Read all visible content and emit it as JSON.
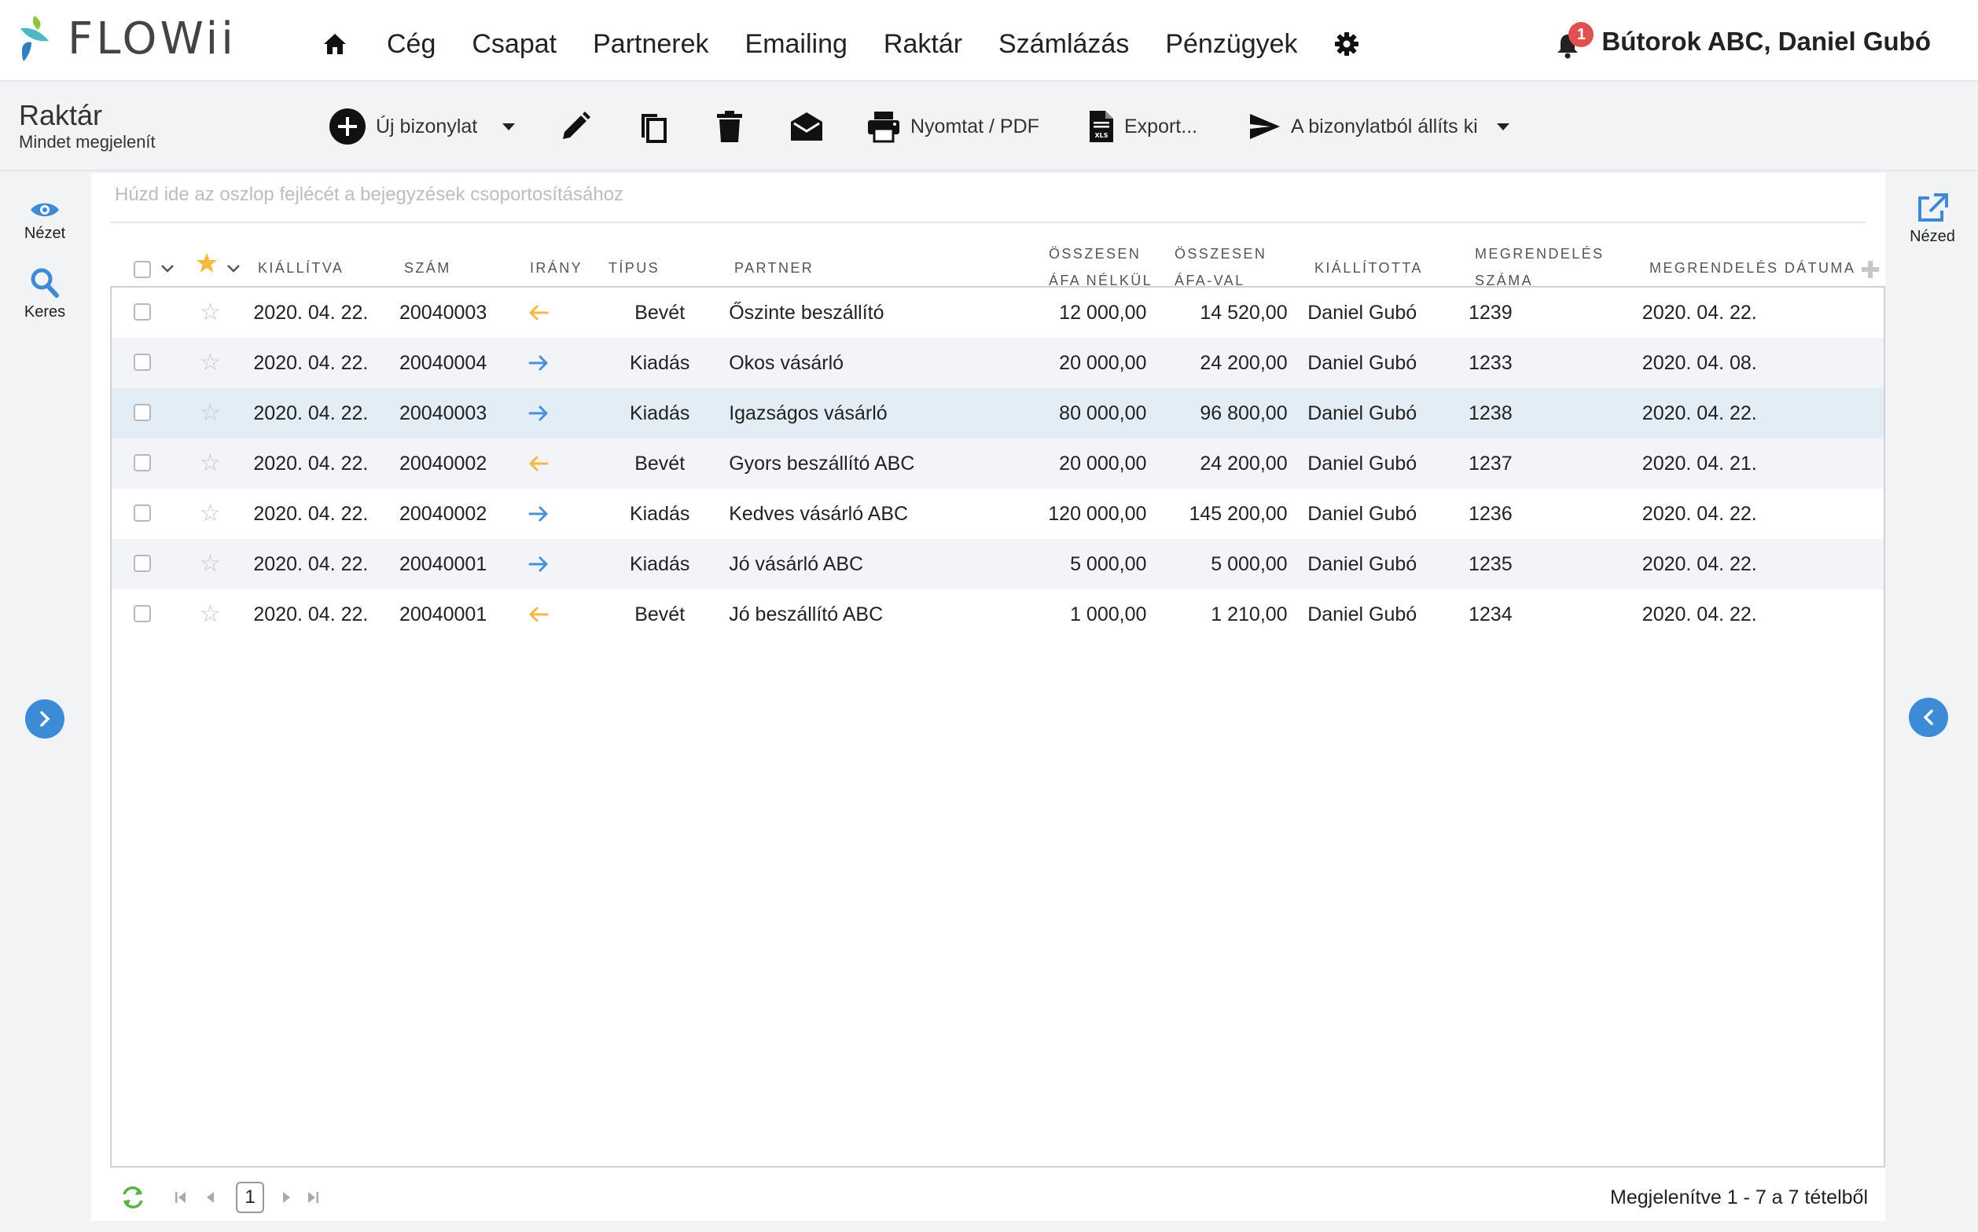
{
  "app": {
    "logo_text": "FLOWii",
    "brand_colors": {
      "teal": "#4bb8c4",
      "green": "#8cc63f",
      "blue": "#2f7fc0"
    }
  },
  "nav": {
    "items": [
      "Cég",
      "Csapat",
      "Partnerek",
      "Emailing",
      "Raktár",
      "Számlázás",
      "Pénzügyek"
    ],
    "home_icon": "home-icon",
    "settings_icon": "gear-icon"
  },
  "user": {
    "notification_count": "1",
    "name": "Bútorok ABC, Daniel Gubó"
  },
  "toolbar": {
    "title": "Raktár",
    "subtitle": "Mindet megjelenít",
    "new_doc": "Új bizonylat",
    "print": "Nyomtat / PDF",
    "export": "Export...",
    "issue_from": "A bizonylatból állíts ki"
  },
  "left_rail": {
    "view": "Nézet",
    "search": "Keres"
  },
  "right_rail": {
    "view": "Nézed"
  },
  "grid": {
    "group_hint": "Húzd ide az oszlop fejlécét a bejegyzések csoportosításához",
    "columns": {
      "issued": "KIÁLLÍTVA",
      "number": "SZÁM",
      "direction": "IRÁNY",
      "type": "TÍPUS",
      "partner": "PARTNER",
      "net_line1": "ÖSSZESEN",
      "net_line2": "ÁFA NÉLKÜL",
      "gross_line1": "ÖSSZESEN",
      "gross_line2": "ÁFA-VAL",
      "issued_by": "KIÁLLÍTOTTA",
      "order_no_line1": "MEGRENDELÉS",
      "order_no_line2": "SZÁMA",
      "order_date": "MEGRENDELÉS DÁTUMA"
    },
    "rows": [
      {
        "issued": "2020. 04. 22.",
        "number": "20040003",
        "direction": "in",
        "type": "Bevét",
        "partner": "Őszinte beszállító",
        "net": "12 000,00",
        "gross": "14 520,00",
        "issued_by": "Daniel Gubó",
        "order_no": "1239",
        "order_date": "2020. 04. 22."
      },
      {
        "issued": "2020. 04. 22.",
        "number": "20040004",
        "direction": "out",
        "type": "Kiadás",
        "partner": "Okos vásárló",
        "net": "20 000,00",
        "gross": "24 200,00",
        "issued_by": "Daniel Gubó",
        "order_no": "1233",
        "order_date": "2020. 04. 08."
      },
      {
        "issued": "2020. 04. 22.",
        "number": "20040003",
        "direction": "out",
        "type": "Kiadás",
        "partner": "Igazságos vásárló",
        "net": "80 000,00",
        "gross": "96 800,00",
        "issued_by": "Daniel Gubó",
        "order_no": "1238",
        "order_date": "2020. 04. 22."
      },
      {
        "issued": "2020. 04. 22.",
        "number": "20040002",
        "direction": "in",
        "type": "Bevét",
        "partner": "Gyors beszállító ABC",
        "net": "20 000,00",
        "gross": "24 200,00",
        "issued_by": "Daniel Gubó",
        "order_no": "1237",
        "order_date": "2020. 04. 21."
      },
      {
        "issued": "2020. 04. 22.",
        "number": "20040002",
        "direction": "out",
        "type": "Kiadás",
        "partner": "Kedves vásárló ABC",
        "net": "120 000,00",
        "gross": "145 200,00",
        "issued_by": "Daniel Gubó",
        "order_no": "1236",
        "order_date": "2020. 04. 22."
      },
      {
        "issued": "2020. 04. 22.",
        "number": "20040001",
        "direction": "out",
        "type": "Kiadás",
        "partner": "Jó vásárló ABC",
        "net": "5 000,00",
        "gross": "5 000,00",
        "issued_by": "Daniel Gubó",
        "order_no": "1235",
        "order_date": "2020. 04. 22."
      },
      {
        "issued": "2020. 04. 22.",
        "number": "20040001",
        "direction": "in",
        "type": "Bevét",
        "partner": "Jó beszállító ABC",
        "net": "1 000,00",
        "gross": "1 210,00",
        "issued_by": "Daniel Gubó",
        "order_no": "1234",
        "order_date": "2020. 04. 22."
      }
    ],
    "selected_row": 2,
    "colors": {
      "in_arrow": "#f5b942",
      "out_arrow": "#4a90d9",
      "accent": "#3d8ad6",
      "star_header": "#f5b942"
    }
  },
  "footer": {
    "page": "1",
    "summary": "Megjelenítve 1 - 7 a 7 tételből"
  }
}
